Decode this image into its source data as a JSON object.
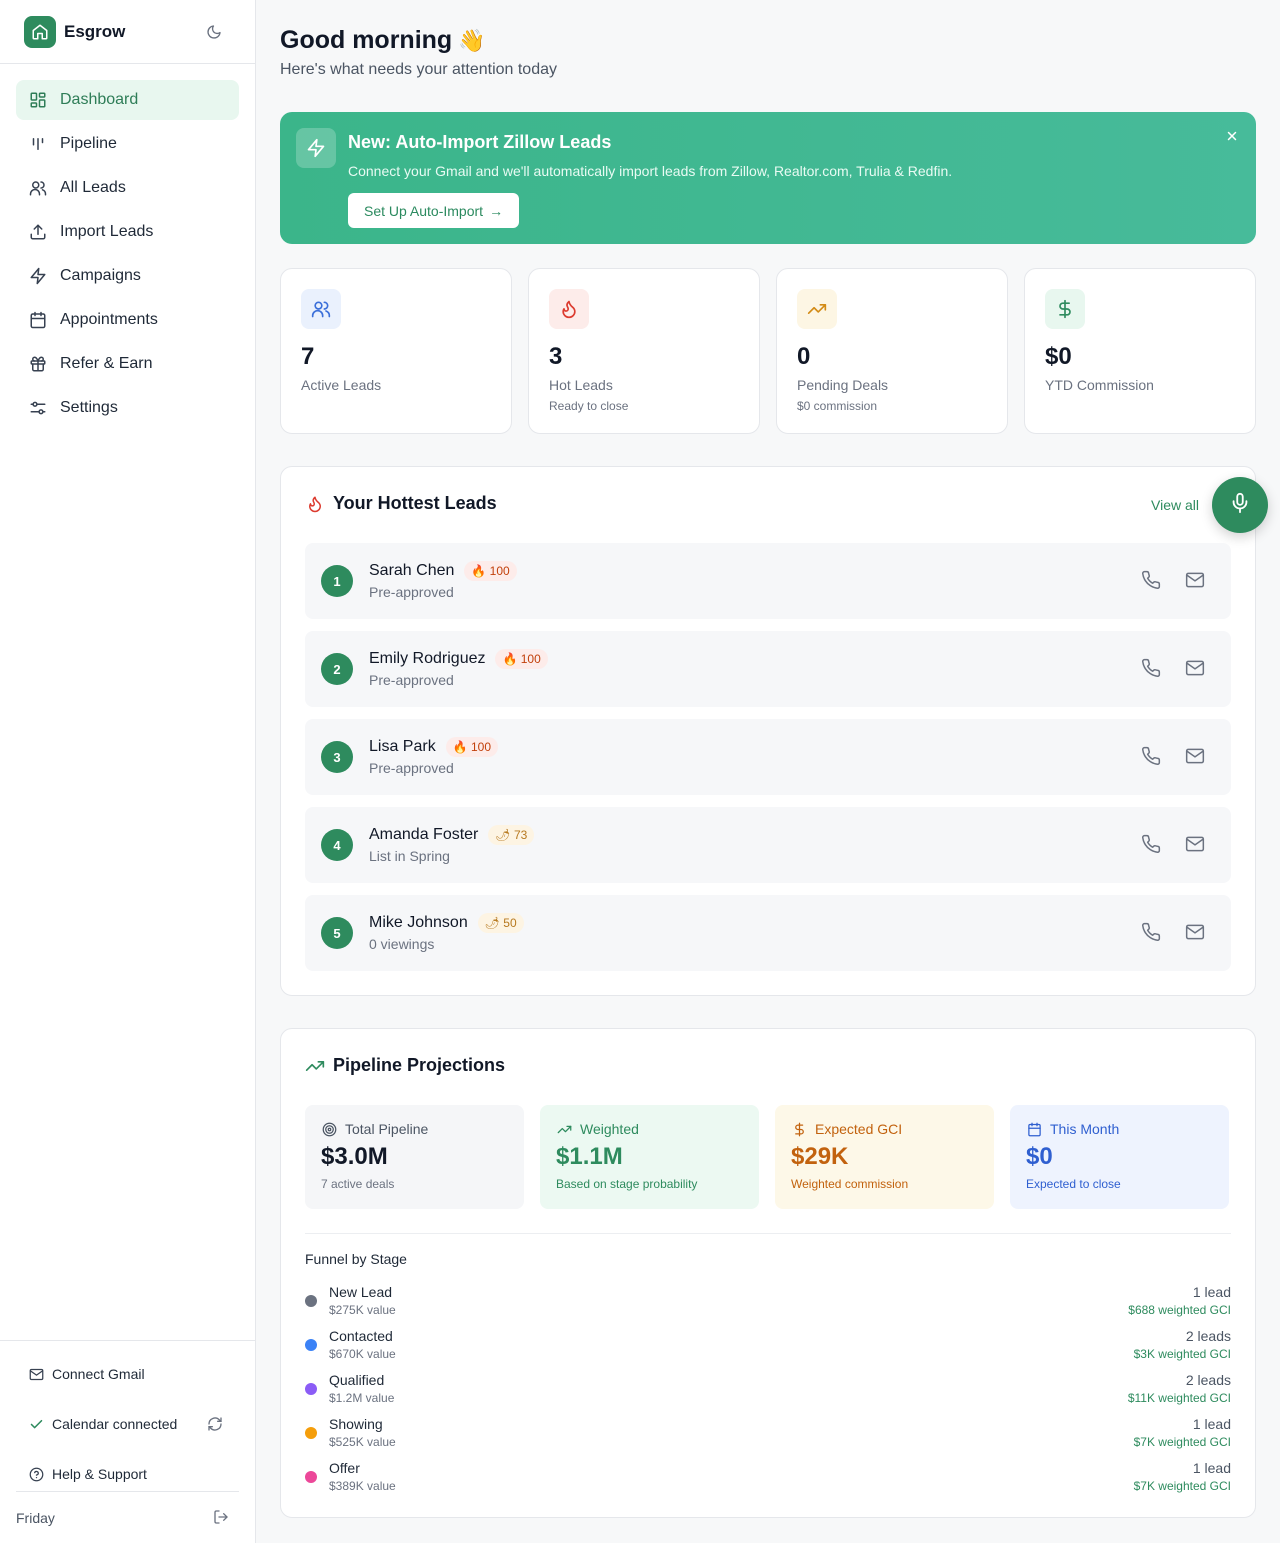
{
  "app": {
    "name": "Esgrow"
  },
  "sidebar": {
    "items": [
      {
        "label": "Dashboard",
        "icon": "dashboard-icon"
      },
      {
        "label": "Pipeline",
        "icon": "pipeline-icon"
      },
      {
        "label": "All Leads",
        "icon": "users-icon"
      },
      {
        "label": "Import Leads",
        "icon": "upload-icon"
      },
      {
        "label": "Campaigns",
        "icon": "zap-icon"
      },
      {
        "label": "Appointments",
        "icon": "calendar-icon"
      },
      {
        "label": "Refer & Earn",
        "icon": "gift-icon"
      },
      {
        "label": "Settings",
        "icon": "sliders-icon"
      }
    ],
    "bottom": {
      "connect_gmail": "Connect Gmail",
      "calendar": "Calendar connected",
      "help": "Help & Support",
      "day": "Friday"
    }
  },
  "header": {
    "greeting": "Good morning",
    "wave": "👋",
    "subtitle": "Here's what needs your attention today"
  },
  "banner": {
    "title": "New: Auto-Import Zillow Leads",
    "text": "Connect your Gmail and we'll automatically import leads from Zillow, Realtor.com, Trulia & Redfin.",
    "button": "Set Up Auto-Import",
    "arrow": "→"
  },
  "stats": [
    {
      "value": "7",
      "label": "Active Leads",
      "sub": ""
    },
    {
      "value": "3",
      "label": "Hot Leads",
      "sub": "Ready to close"
    },
    {
      "value": "0",
      "label": "Pending Deals",
      "sub": "$0 commission"
    },
    {
      "value": "$0",
      "label": "YTD Commission",
      "sub": ""
    }
  ],
  "hottest": {
    "title": "Your Hottest Leads",
    "view_all": "View all",
    "leads": [
      {
        "rank": "1",
        "name": "Sarah Chen",
        "score": "🔥 100",
        "status": "Pre-approved"
      },
      {
        "rank": "2",
        "name": "Emily Rodriguez",
        "score": "🔥 100",
        "status": "Pre-approved"
      },
      {
        "rank": "3",
        "name": "Lisa Park",
        "score": "🔥 100",
        "status": "Pre-approved"
      },
      {
        "rank": "4",
        "name": "Amanda Foster",
        "score": "🌶 73",
        "status": "List in Spring"
      },
      {
        "rank": "5",
        "name": "Mike Johnson",
        "score": "🌶 50",
        "status": "0 viewings"
      }
    ]
  },
  "projections": {
    "title": "Pipeline Projections",
    "tiles": [
      {
        "label": "Total Pipeline",
        "value": "$3.0M",
        "sub": "7 active deals",
        "color": "#111827"
      },
      {
        "label": "Weighted",
        "value": "$1.1M",
        "sub": "Based on stage probability",
        "color": "#2e8b5e"
      },
      {
        "label": "Expected GCI",
        "value": "$29K",
        "sub": "Weighted commission",
        "color": "#c2620e"
      },
      {
        "label": "This Month",
        "value": "$0",
        "sub": "Expected to close",
        "color": "#2f5fd0"
      }
    ],
    "funnel_title": "Funnel by Stage",
    "funnel": [
      {
        "stage": "New Lead",
        "value": "$275K value",
        "count": "1 lead",
        "gci": "$688 weighted GCI",
        "color": "#6b7280"
      },
      {
        "stage": "Contacted",
        "value": "$670K value",
        "count": "2 leads",
        "gci": "$3K weighted GCI",
        "color": "#3b82f6"
      },
      {
        "stage": "Qualified",
        "value": "$1.2M value",
        "count": "2 leads",
        "gci": "$11K weighted GCI",
        "color": "#8b5cf6"
      },
      {
        "stage": "Showing",
        "value": "$525K value",
        "count": "1 lead",
        "gci": "$7K weighted GCI",
        "color": "#f59e0b"
      },
      {
        "stage": "Offer",
        "value": "$389K value",
        "count": "1 lead",
        "gci": "$7K weighted GCI",
        "color": "#ec4899"
      }
    ]
  }
}
